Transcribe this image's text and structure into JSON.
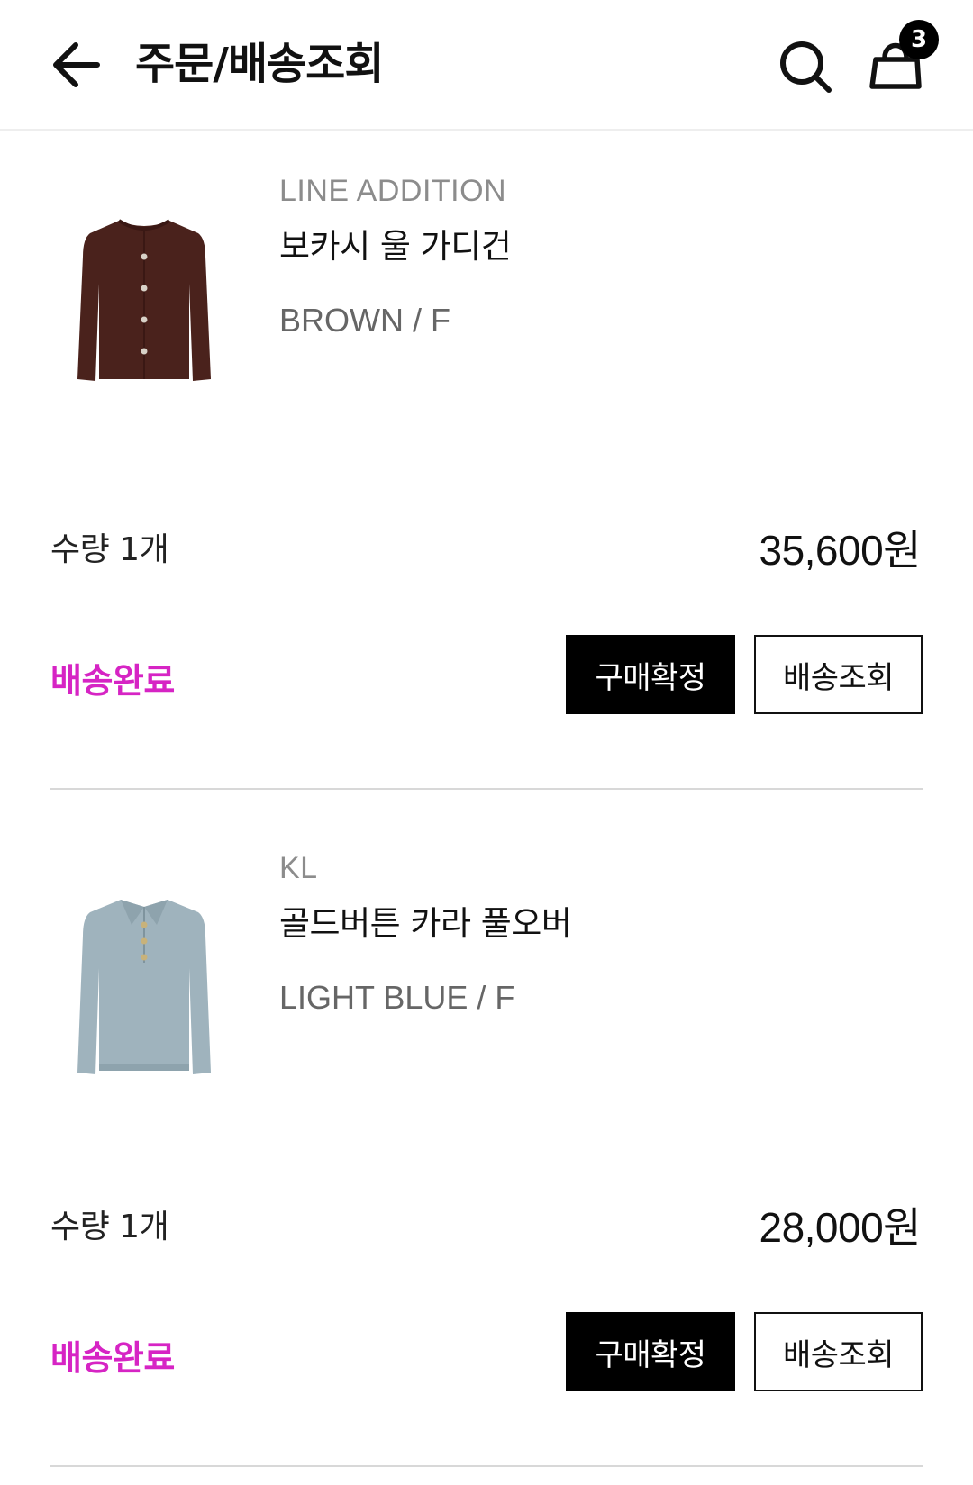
{
  "header": {
    "title": "주문/배송조회",
    "cart_count": "3",
    "back_icon": "arrow-left-icon",
    "search_icon": "search-icon",
    "cart_icon": "shopping-bag-icon"
  },
  "orders": [
    {
      "brand": "LINE ADDITION",
      "name": "보카시 울 가디건",
      "option": "BROWN / F",
      "quantity": "수량 1개",
      "price": "35,600원",
      "status": "배송완료",
      "confirm_label": "구매확정",
      "track_label": "배송조회",
      "thumbnail": "brown-cardigan-image",
      "garment_color": "#4a221c"
    },
    {
      "brand": "KL",
      "name": "골드버튼 카라 풀오버",
      "option": "LIGHT BLUE / F",
      "quantity": "수량 1개",
      "price": "28,000원",
      "status": "배송완료",
      "confirm_label": "구매확정",
      "track_label": "배송조회",
      "thumbnail": "light-blue-collar-pullover-image",
      "garment_color": "#9fb3bd"
    }
  ],
  "colors": {
    "status": "#d624c4",
    "primary_button": "#000000",
    "divider": "#d8d8d8"
  }
}
